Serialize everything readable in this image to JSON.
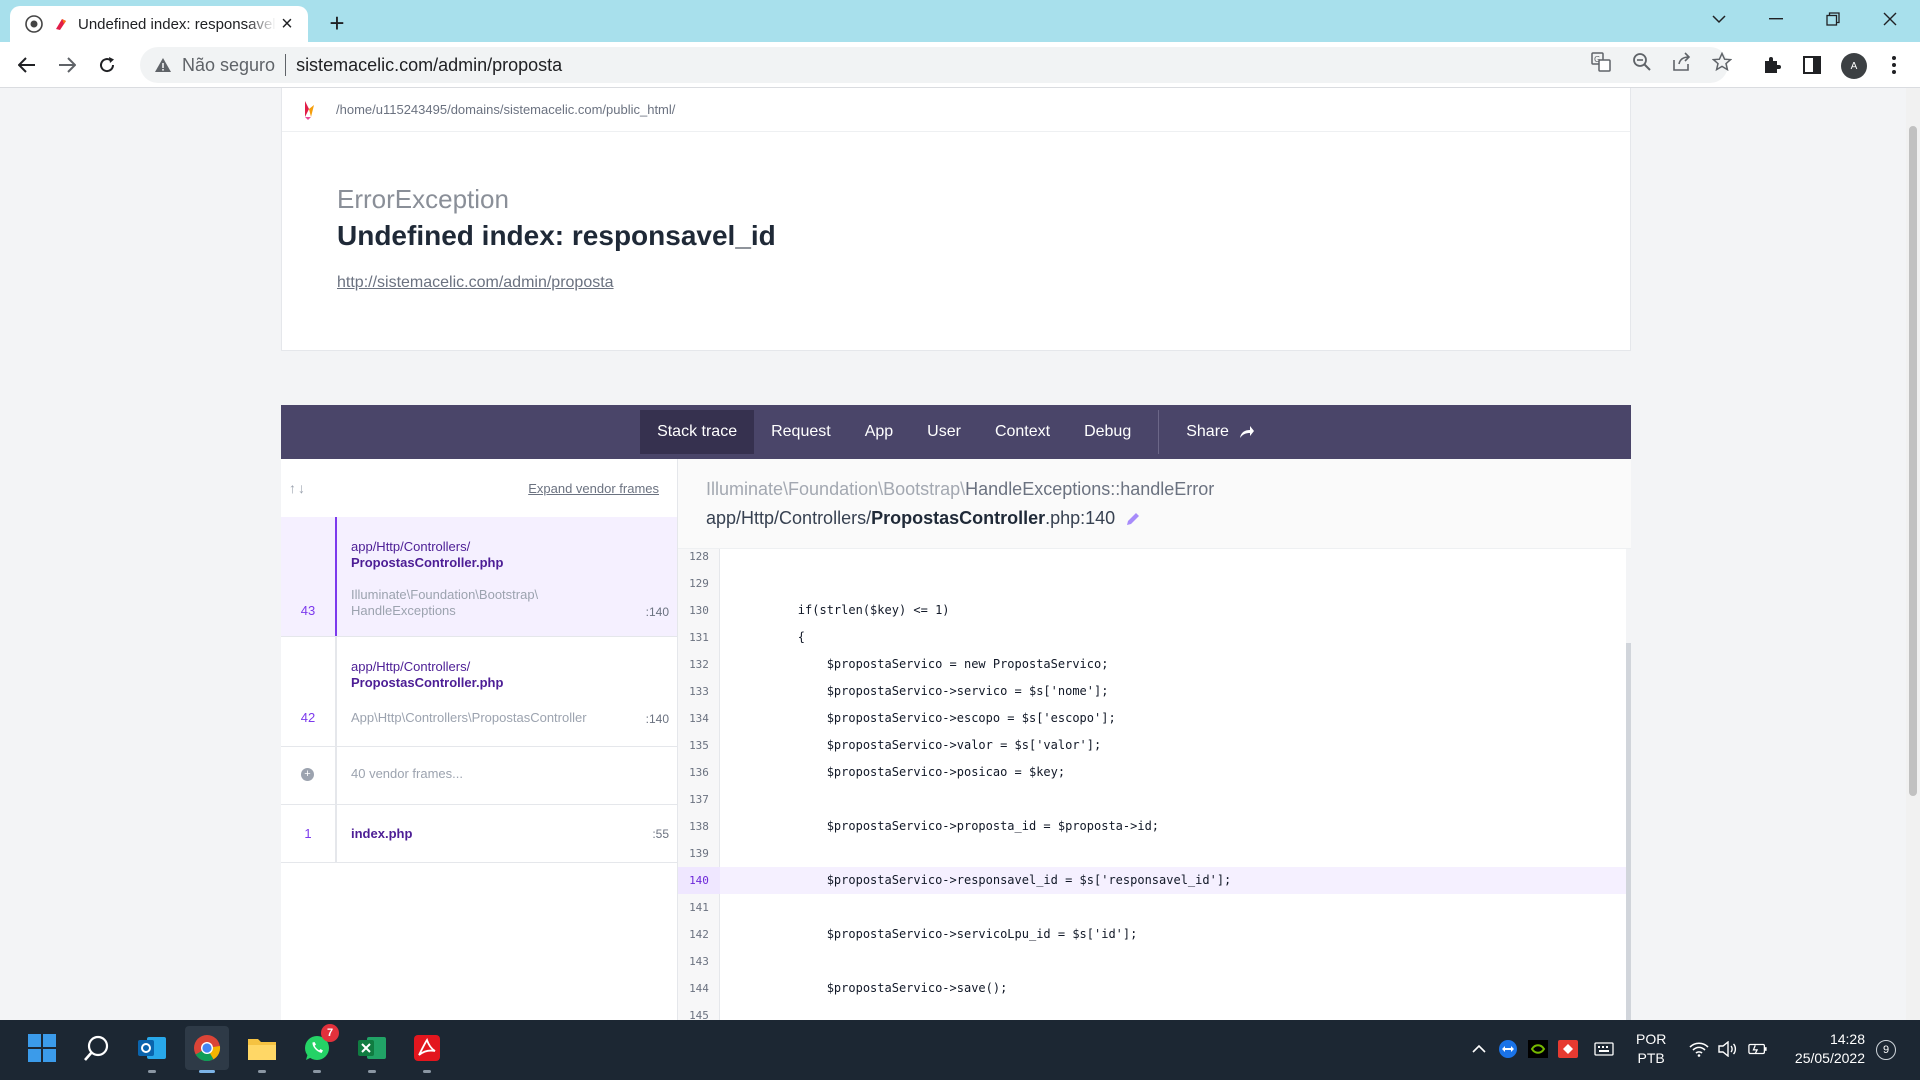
{
  "browser": {
    "tab_title": "Undefined index: responsavel_id",
    "address_security": "Não seguro",
    "url": "sistemacelic.com/admin/proposta"
  },
  "error_page": {
    "path": "/home/u115243495/domains/sistemacelic.com/public_html/",
    "exception_class": "ErrorException",
    "message": "Undefined index: responsavel_id",
    "request_url": "http://sistemacelic.com/admin/proposta",
    "tabs": [
      {
        "label": "Stack trace"
      },
      {
        "label": "Request"
      },
      {
        "label": "App"
      },
      {
        "label": "User"
      },
      {
        "label": "Context"
      },
      {
        "label": "Debug"
      },
      {
        "label": "Share"
      }
    ],
    "frames_header": {
      "arrows": "↑↓",
      "expand_label": "Expand vendor frames"
    },
    "frames": [
      {
        "number": "43",
        "file_dir": "app/Http/Controllers/",
        "file_name": "PropostasController.php",
        "class_line1": "Illuminate\\Foundation\\Bootstrap\\",
        "class_line2": "HandleExceptions",
        "line": ":140"
      },
      {
        "number": "42",
        "file_dir": "app/Http/Controllers/",
        "file_name": "PropostasController.php",
        "class_line1": "App\\Http\\Controllers\\PropostasController",
        "line": ":140"
      },
      {
        "vendor_label": "40 vendor frames..."
      },
      {
        "number": "1",
        "file_name": "index.php",
        "line": ":55"
      }
    ],
    "code_header": {
      "namespace": "Illuminate\\Foundation\\Bootstrap\\",
      "class_method": "HandleExceptions::handleError",
      "file_dir": "app/Http/Controllers/",
      "file_name": "PropostasController",
      "file_ext": ".php:140"
    },
    "code_lines": [
      {
        "no": "128",
        "code": ""
      },
      {
        "no": "129",
        "code": ""
      },
      {
        "no": "130",
        "code": "        if(strlen($key) <= 1)"
      },
      {
        "no": "131",
        "code": "        {"
      },
      {
        "no": "132",
        "code": "            $propostaServico = new PropostaServico;"
      },
      {
        "no": "133",
        "code": "            $propostaServico->servico = $s['nome'];"
      },
      {
        "no": "134",
        "code": "            $propostaServico->escopo = $s['escopo'];"
      },
      {
        "no": "135",
        "code": "            $propostaServico->valor = $s['valor'];"
      },
      {
        "no": "136",
        "code": "            $propostaServico->posicao = $key;"
      },
      {
        "no": "137",
        "code": ""
      },
      {
        "no": "138",
        "code": "            $propostaServico->proposta_id = $proposta->id;"
      },
      {
        "no": "139",
        "code": ""
      },
      {
        "no": "140",
        "code": "            $propostaServico->responsavel_id = $s['responsavel_id'];"
      },
      {
        "no": "141",
        "code": ""
      },
      {
        "no": "142",
        "code": "            $propostaServico->servicoLpu_id = $s['id'];"
      },
      {
        "no": "143",
        "code": ""
      },
      {
        "no": "144",
        "code": "            $propostaServico->save();"
      },
      {
        "no": "145",
        "code": ""
      }
    ],
    "highlighted_line": "140"
  },
  "taskbar": {
    "whatsapp_badge": "7",
    "language": "POR",
    "keyboard": "PTB",
    "time": "14:28",
    "date": "25/05/2022",
    "notifications": "9"
  },
  "colors": {
    "tabstrip": "#a8e0ec",
    "tabsbar": "#4a4569",
    "accent": "#7c3aed",
    "taskbar": "#1c2733"
  }
}
